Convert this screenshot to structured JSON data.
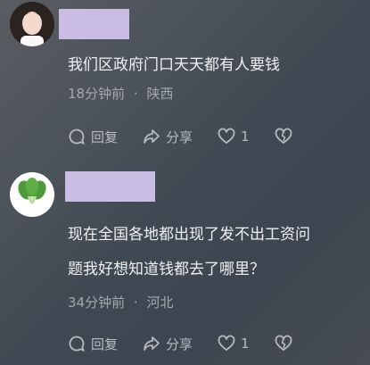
{
  "comments": [
    {
      "text_lines": [
        "我们区政府门口天天都有人要钱"
      ],
      "time": "18分钟前",
      "location": "陕西",
      "reply_label": "回复",
      "share_label": "分享",
      "likes": "1",
      "avatar_icon": "person-photo",
      "name_bar_color": "#c9bde4"
    },
    {
      "text_lines": [
        "现在全国各地都出现了发不出工资问",
        "题我好想知道钱都去了哪里？"
      ],
      "time": "34分钟前",
      "location": "河北",
      "reply_label": "回复",
      "share_label": "分享",
      "likes": "1",
      "avatar_icon": "bok-choy-icon",
      "name_bar_color": "#c9bde4"
    }
  ],
  "meta_separator": "·"
}
